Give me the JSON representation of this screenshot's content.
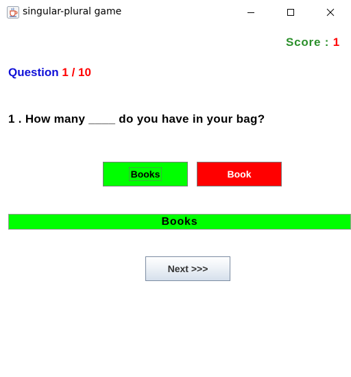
{
  "window": {
    "title": "singular-plural game",
    "icon": "java-cup-icon"
  },
  "score": {
    "label": "Score : ",
    "value": "1",
    "label_color": "#2a8f2a",
    "value_color": "#ff0000"
  },
  "question_counter": {
    "label": "Question ",
    "value": "1 / 10",
    "label_color": "#1010d8",
    "value_color": "#ff0000"
  },
  "question": {
    "text": "1 . How many ____ do you have in your bag?"
  },
  "answers": [
    {
      "label": "Books",
      "state": "selected-correct",
      "color": "#00ff00"
    },
    {
      "label": "Book",
      "state": "incorrect",
      "color": "#ff0000"
    }
  ],
  "result": {
    "text": "Books",
    "color": "#00ff00"
  },
  "navigation": {
    "next_label": "Next >>>"
  }
}
